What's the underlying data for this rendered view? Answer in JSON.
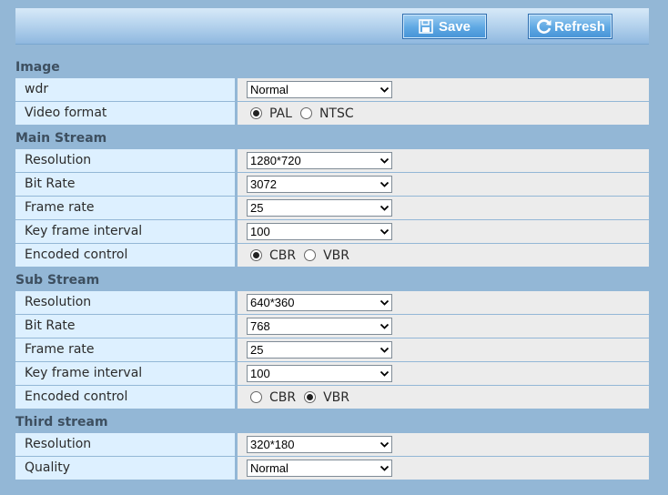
{
  "toolbar": {
    "save_label": "Save",
    "save_icon": "floppy-disk-icon",
    "refresh_label": "Refresh",
    "refresh_icon": "refresh-icon"
  },
  "image": {
    "title": "Image",
    "wdr": {
      "label": "wdr",
      "value": "Normal"
    },
    "video_format": {
      "label": "Video format",
      "options": [
        "PAL",
        "NTSC"
      ],
      "selected": "PAL"
    }
  },
  "main_stream": {
    "title": "Main Stream",
    "resolution": {
      "label": "Resolution",
      "value": "1280*720"
    },
    "bit_rate": {
      "label": "Bit Rate",
      "value": "3072"
    },
    "frame_rate": {
      "label": "Frame rate",
      "value": "25"
    },
    "key_frame_interval": {
      "label": "Key frame interval",
      "value": "100"
    },
    "encoded_control": {
      "label": "Encoded control",
      "options": [
        "CBR",
        "VBR"
      ],
      "selected": "CBR"
    }
  },
  "sub_stream": {
    "title": "Sub Stream",
    "resolution": {
      "label": "Resolution",
      "value": "640*360"
    },
    "bit_rate": {
      "label": "Bit Rate",
      "value": "768"
    },
    "frame_rate": {
      "label": "Frame rate",
      "value": "25"
    },
    "key_frame_interval": {
      "label": "Key frame interval",
      "value": "100"
    },
    "encoded_control": {
      "label": "Encoded control",
      "options": [
        "CBR",
        "VBR"
      ],
      "selected": "VBR"
    }
  },
  "third_stream": {
    "title": "Third stream",
    "resolution": {
      "label": "Resolution",
      "value": "320*180"
    },
    "quality": {
      "label": "Quality",
      "value": "Normal"
    }
  },
  "colors": {
    "page_background": "#93b7d6",
    "label_cell": "#ddf0ff",
    "value_cell": "#ececec",
    "button_blue": "#5ea8e3"
  }
}
